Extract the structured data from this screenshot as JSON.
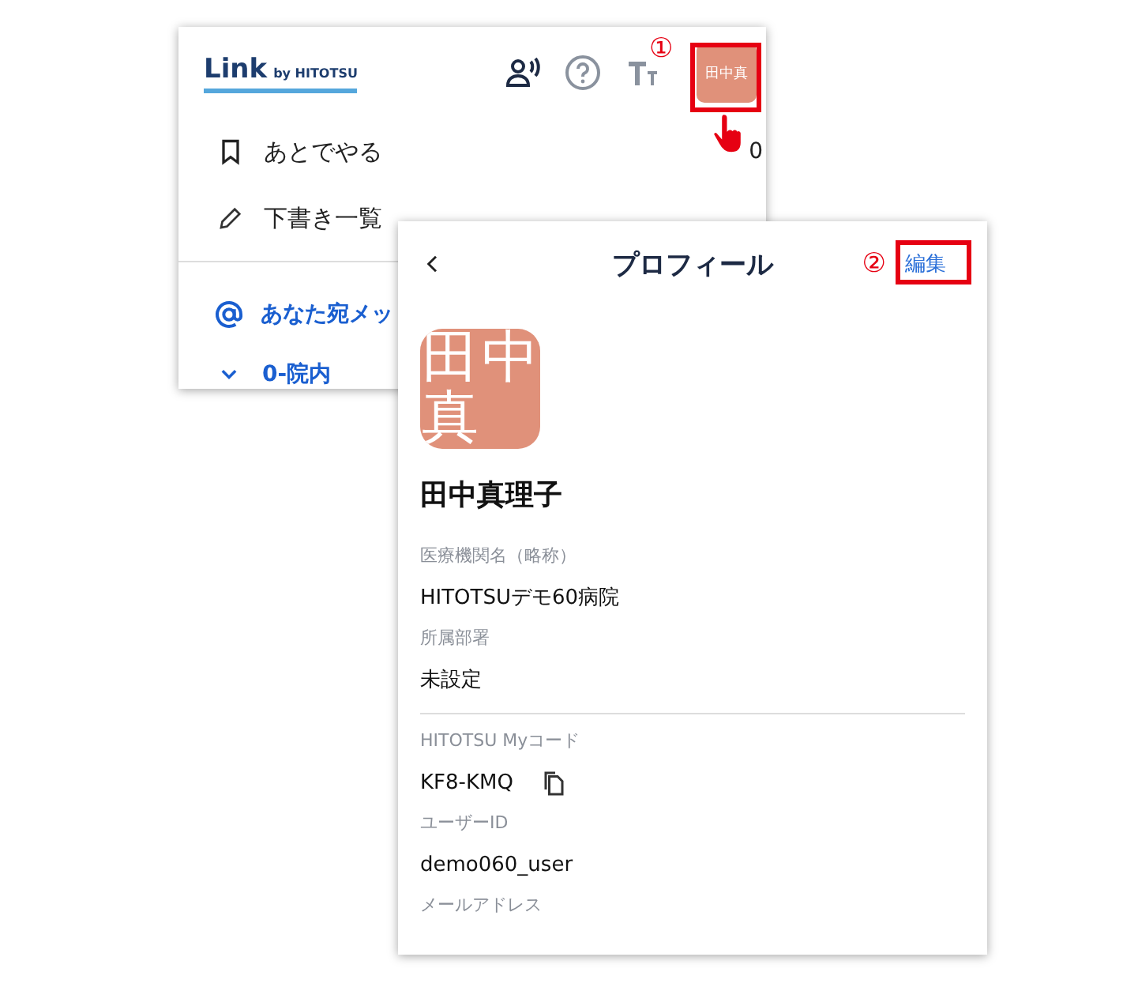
{
  "menu_panel": {
    "logo": {
      "name": "Link",
      "byline": "by HITOTSU"
    },
    "avatar": "田中真",
    "step_marker": "①",
    "items": [
      {
        "kind": "bookmark",
        "label": "あとでやる",
        "count": "0"
      },
      {
        "kind": "draft",
        "label": "下書き一覧"
      }
    ],
    "channels": [
      {
        "kind": "mention",
        "label": "あなた宛メッ"
      },
      {
        "kind": "group",
        "label": "0-院内"
      }
    ]
  },
  "profile_panel": {
    "title": "プロフィール",
    "step_marker": "②",
    "edit": "編集",
    "avatar_chars": [
      "田",
      "中",
      "真"
    ],
    "name": "田中真理子",
    "fields": [
      {
        "label": "医療機関名（略称）",
        "value": "HITOTSUデモ60病院",
        "divider_before": false,
        "copyable": false
      },
      {
        "label": "所属部署",
        "value": "未設定",
        "divider_before": false,
        "copyable": false
      },
      {
        "label": "HITOTSU Myコード",
        "value": "KF8-KMQ",
        "divider_before": true,
        "copyable": true
      },
      {
        "label": "ユーザーID",
        "value": "demo060_user",
        "divider_before": false,
        "copyable": false
      },
      {
        "label": "メールアドレス",
        "divider_before": false
      }
    ]
  }
}
